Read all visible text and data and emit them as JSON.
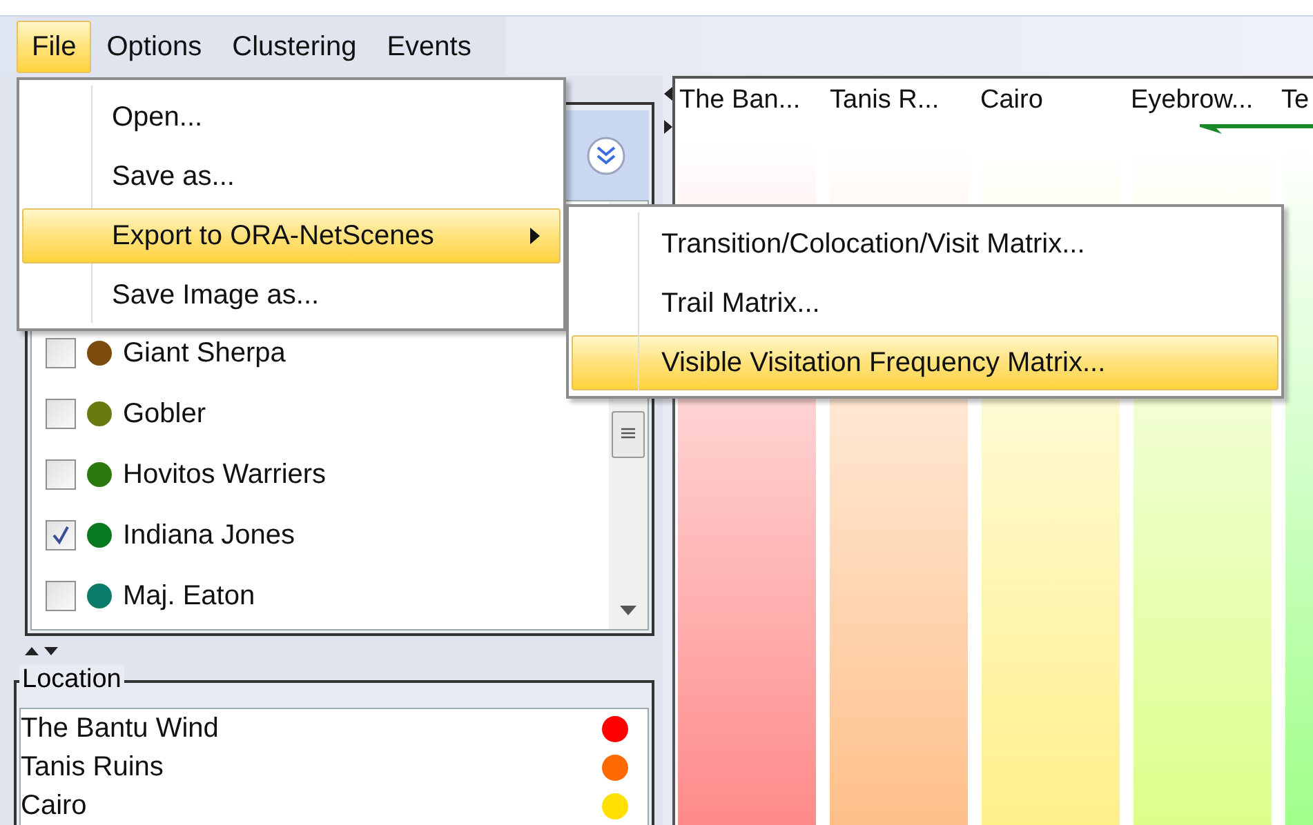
{
  "menu_bar": [
    {
      "label": "File",
      "selected": true
    },
    {
      "label": "Options",
      "selected": false
    },
    {
      "label": "Clustering",
      "selected": false
    },
    {
      "label": "Events",
      "selected": false
    }
  ],
  "file_menu": [
    {
      "label": "Open...",
      "selected": false,
      "submenu": false
    },
    {
      "label": "Save as...",
      "selected": false,
      "submenu": false
    },
    {
      "label": "Export to ORA-NetScenes",
      "selected": true,
      "submenu": true
    },
    {
      "label": "Save Image as...",
      "selected": false,
      "submenu": false
    }
  ],
  "export_submenu": [
    {
      "label": "Transition/Colocation/Visit Matrix...",
      "selected": false
    },
    {
      "label": "Trail Matrix...",
      "selected": false
    },
    {
      "label": "Visible Visitation Frequency Matrix...",
      "selected": true
    }
  ],
  "agents": [
    {
      "name": "Giant Sherpa",
      "checked": false,
      "color": "#7b4a0c"
    },
    {
      "name": "Gobler",
      "checked": false,
      "color": "#6b7a10"
    },
    {
      "name": "Hovitos Warriers",
      "checked": false,
      "color": "#2a7a10"
    },
    {
      "name": "Indiana Jones",
      "checked": true,
      "color": "#0a7a20"
    },
    {
      "name": "Maj. Eaton",
      "checked": false,
      "color": "#0a7a6a"
    }
  ],
  "location": {
    "title": "Location",
    "rows": [
      {
        "name": "The Bantu Wind",
        "color": "#ff0000"
      },
      {
        "name": "Tanis Ruins",
        "color": "#ff6a00"
      },
      {
        "name": "Cairo",
        "color": "#ffe000"
      }
    ]
  },
  "canvas": {
    "columns": [
      {
        "label": "The Ban...",
        "color": "#ff8a8a"
      },
      {
        "label": "Tanis R...",
        "color": "#ffc08a"
      },
      {
        "label": "Cairo",
        "color": "#fff08a"
      },
      {
        "label": "Eyebrow...",
        "color": "#dcff8a"
      },
      {
        "label": "Te",
        "color": "#a0ff8a"
      }
    ]
  }
}
